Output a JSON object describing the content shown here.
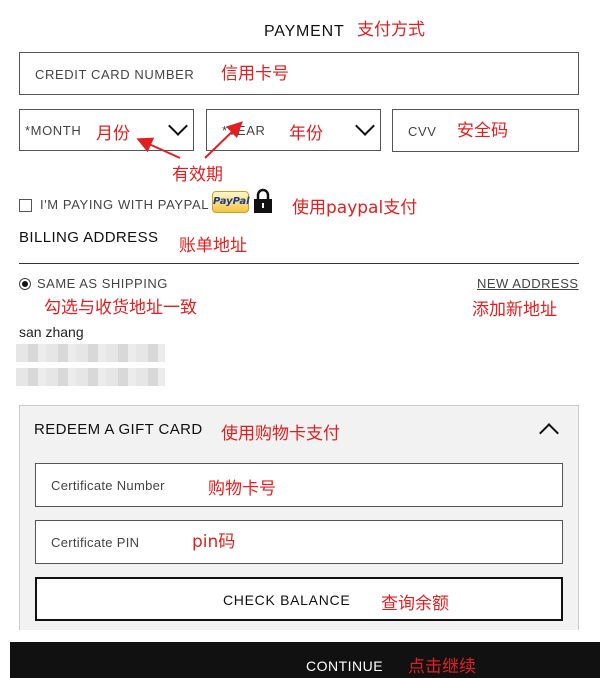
{
  "header": {
    "title": "PAYMENT",
    "note": "支付方式"
  },
  "card_number": {
    "label": "CREDIT CARD NUMBER",
    "note": "信用卡号"
  },
  "expiry": {
    "month_label": "*MONTH",
    "month_note": "月份",
    "year_label": "*YEAR",
    "year_note": "年份",
    "note": "有效期"
  },
  "cvv": {
    "label": "CVV",
    "note": "安全码"
  },
  "paypal": {
    "label": "I'M PAYING WITH PAYPAL",
    "badge": "PayPal",
    "note": "使用paypal支付"
  },
  "billing": {
    "title": "BILLING ADDRESS",
    "note": "账单地址",
    "same_label": "SAME AS SHIPPING",
    "same_note": "勾选与收货地址一致",
    "new_address": "NEW ADDRESS",
    "new_note": "添加新地址",
    "name": "san zhang"
  },
  "gift": {
    "title": "REDEEM A GIFT CARD",
    "note": "使用购物卡支付",
    "cert_number": "Certificate Number",
    "cert_number_note": "购物卡号",
    "cert_pin": "Certificate PIN",
    "cert_pin_note": "pin码",
    "check_balance": "CHECK BALANCE",
    "check_note": "查询余额"
  },
  "continue": {
    "label": "CONTINUE",
    "note": "点击继续"
  },
  "colors": {
    "annotation": "#e02020",
    "border": "#555555",
    "panel": "#f2f2f2",
    "continue_bg": "#111111"
  }
}
